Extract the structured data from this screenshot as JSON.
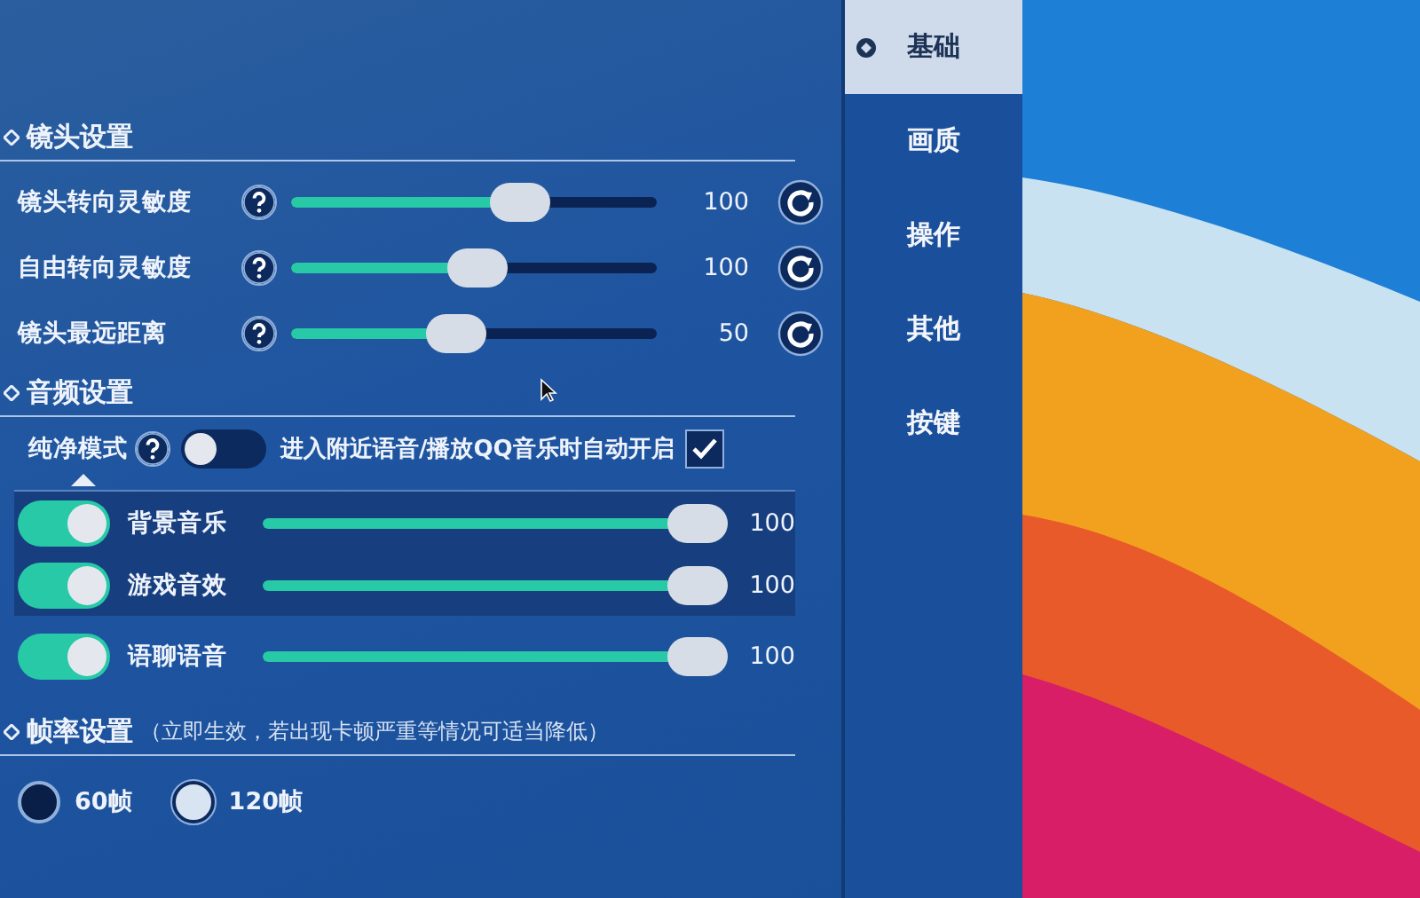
{
  "camera": {
    "title": "镜头设置",
    "sliders": [
      {
        "label": "镜头转向灵敏度",
        "level": 0.65,
        "value": "100"
      },
      {
        "label": "自由转向灵敏度",
        "level": 0.51,
        "value": "100"
      },
      {
        "label": "镜头最远距离",
        "level": 0.44,
        "value": "50"
      }
    ]
  },
  "audio": {
    "title": "音频设置",
    "pure_mode": {
      "label": "纯净模式",
      "on": false
    },
    "auto_enable": {
      "label": "进入附近语音/播放QQ音乐时自动开启",
      "checked": true
    },
    "channels": [
      {
        "label": "背景音乐",
        "on": true,
        "level": 1,
        "value": "100",
        "highlighted": true
      },
      {
        "label": "游戏音效",
        "on": true,
        "level": 1,
        "value": "100",
        "highlighted": true
      },
      {
        "label": "语聊语音",
        "on": true,
        "level": 1,
        "value": "100",
        "highlighted": false
      }
    ]
  },
  "frame_rate": {
    "title": "帧率设置",
    "note": "（立即生效，若出现卡顿严重等情况可适当降低）",
    "options": [
      {
        "label": "60帧",
        "selected": false
      },
      {
        "label": "120帧",
        "selected": true
      }
    ]
  },
  "sidebar": {
    "items": [
      {
        "label": "基础",
        "selected": true
      },
      {
        "label": "画质",
        "selected": false
      },
      {
        "label": "操作",
        "selected": false
      },
      {
        "label": "其他",
        "selected": false
      },
      {
        "label": "按键",
        "selected": false
      }
    ]
  }
}
